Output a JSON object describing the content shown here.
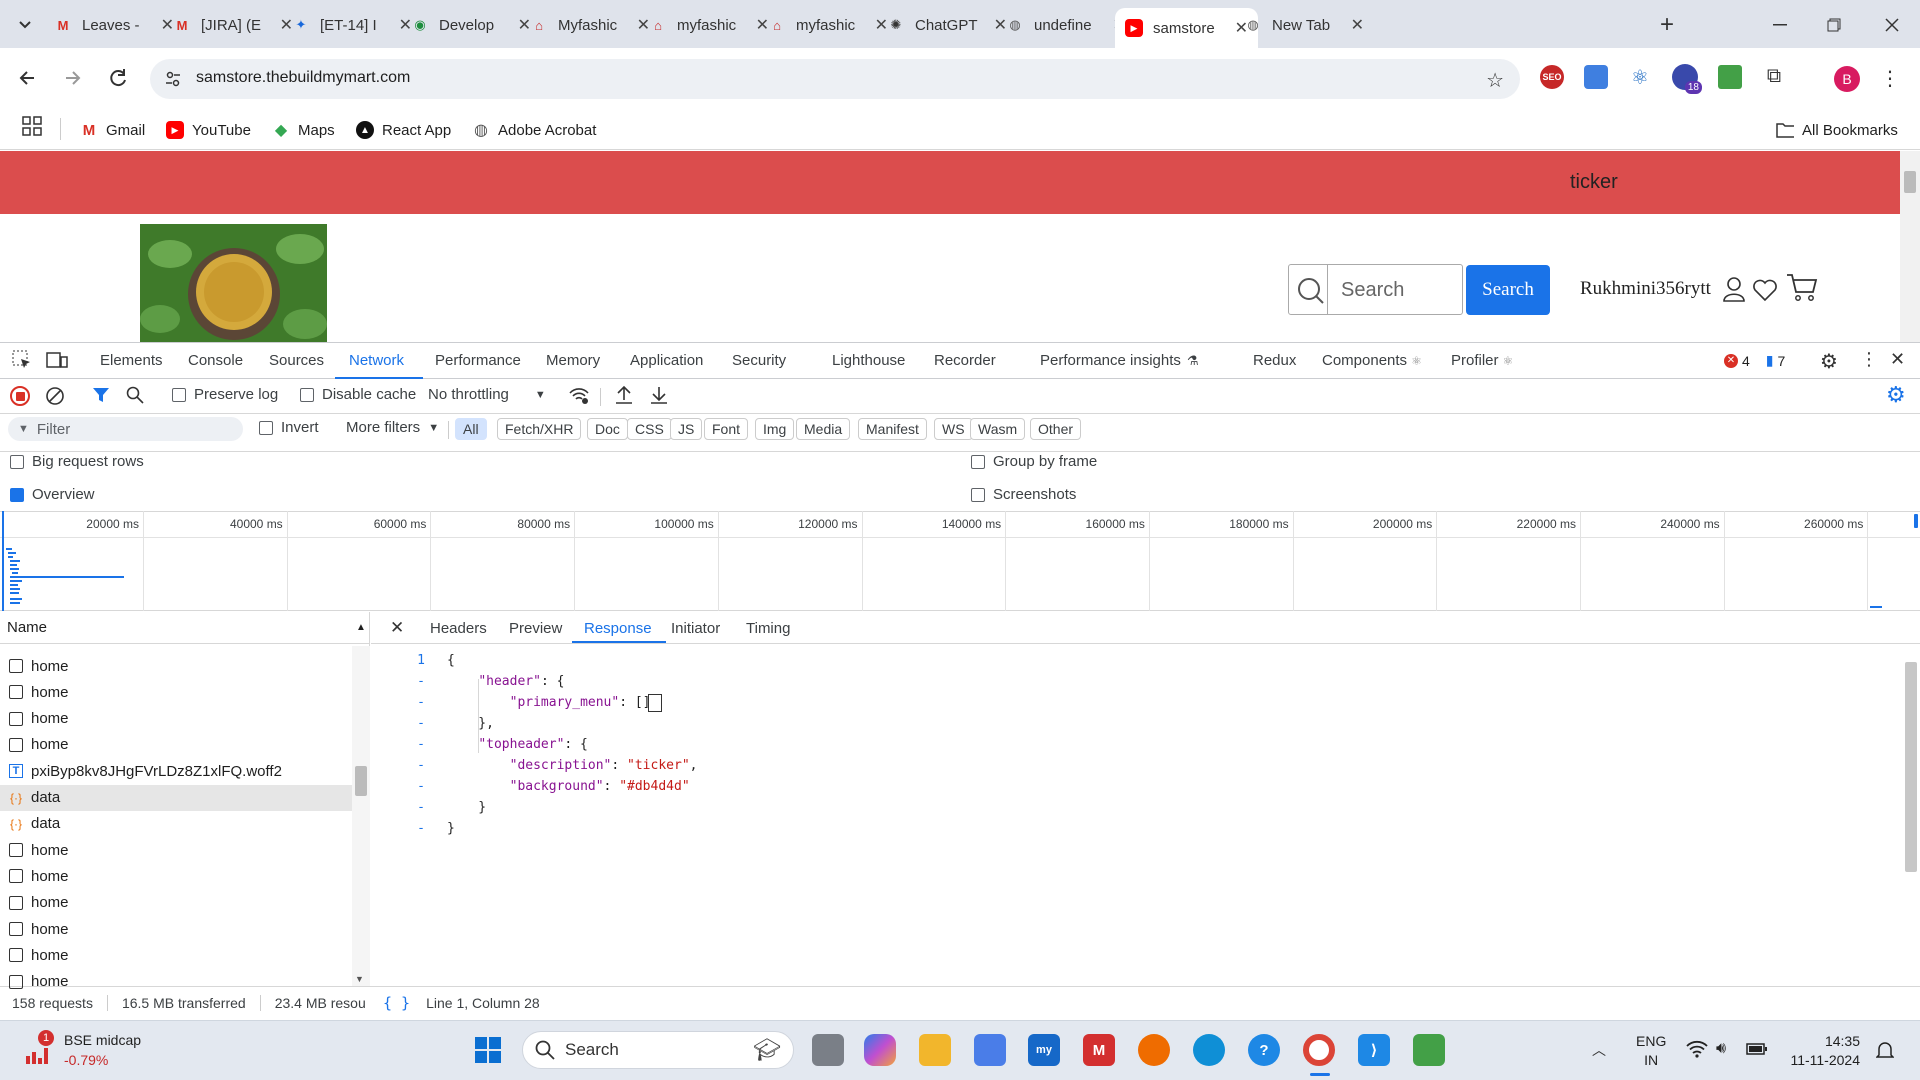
{
  "browser": {
    "tabs": [
      {
        "title": "Leaves -",
        "icon": "gmail-icon"
      },
      {
        "title": "[JIRA] (E",
        "icon": "gmail-icon"
      },
      {
        "title": "[ET-14] I",
        "icon": "jira-icon"
      },
      {
        "title": "Develop",
        "icon": "google-chat-icon"
      },
      {
        "title": "Myfashic",
        "icon": "myfashion-icon"
      },
      {
        "title": "myfashic",
        "icon": "myfashion-icon"
      },
      {
        "title": "myfashic",
        "icon": "myfashion-icon"
      },
      {
        "title": "ChatGPT",
        "icon": "chatgpt-icon"
      },
      {
        "title": "undefine",
        "icon": "globe-icon"
      },
      {
        "title": "samstore",
        "icon": "youtube-icon",
        "active": true
      },
      {
        "title": "New Tab",
        "icon": "chrome-icon"
      }
    ],
    "url": "samstore.thebuildmymart.com",
    "profile_initial": "B",
    "extension_badge": "18",
    "bookmarks": [
      "Gmail",
      "YouTube",
      "Maps",
      "React App",
      "Adobe Acrobat"
    ],
    "all_bookmarks": "All Bookmarks"
  },
  "page": {
    "ticker_text": "ticker",
    "ticker_color": "#db4d4d",
    "search_placeholder": "Search",
    "search_button": "Search",
    "username": "Rukhmini356rytt"
  },
  "devtools": {
    "tabs": [
      "Elements",
      "Console",
      "Sources",
      "Network",
      "Performance",
      "Memory",
      "Application",
      "Security",
      "Lighthouse",
      "Recorder",
      "Performance insights",
      "Redux",
      "Components",
      "Profiler"
    ],
    "active_tab": "Network",
    "error_count": "4",
    "message_count": "7",
    "preserve_log": "Preserve log",
    "disable_cache": "Disable cache",
    "throttling": "No throttling",
    "filter_placeholder": "Filter",
    "invert": "Invert",
    "more_filters": "More filters",
    "type_filters": [
      "All",
      "Fetch/XHR",
      "Doc",
      "CSS",
      "JS",
      "Font",
      "Img",
      "Media",
      "Manifest",
      "WS",
      "Wasm",
      "Other"
    ],
    "big_request_rows": "Big request rows",
    "overview": "Overview",
    "group_by_frame": "Group by frame",
    "screenshots": "Screenshots",
    "timeline_ticks": [
      "20000 ms",
      "40000 ms",
      "60000 ms",
      "80000 ms",
      "100000 ms",
      "120000 ms",
      "140000 ms",
      "160000 ms",
      "180000 ms",
      "200000 ms",
      "220000 ms",
      "240000 ms",
      "260000 ms"
    ],
    "name_header": "Name",
    "requests": [
      {
        "name": "home",
        "type": "doc"
      },
      {
        "name": "home",
        "type": "doc"
      },
      {
        "name": "home",
        "type": "doc"
      },
      {
        "name": "home",
        "type": "doc"
      },
      {
        "name": "pxiByp8kv8JHgFVrLDz8Z1xlFQ.woff2",
        "type": "font"
      },
      {
        "name": "data",
        "type": "xhr",
        "selected": true
      },
      {
        "name": "data",
        "type": "xhr"
      },
      {
        "name": "home",
        "type": "doc"
      },
      {
        "name": "home",
        "type": "doc"
      },
      {
        "name": "home",
        "type": "doc"
      },
      {
        "name": "home",
        "type": "doc"
      },
      {
        "name": "home",
        "type": "doc"
      },
      {
        "name": "home",
        "type": "doc"
      }
    ],
    "detail_tabs": [
      "Headers",
      "Preview",
      "Response",
      "Initiator",
      "Timing"
    ],
    "active_detail_tab": "Response",
    "response_lines": [
      {
        "n": "1",
        "text": "{"
      },
      {
        "n": "-",
        "text": "    \"header\": {"
      },
      {
        "n": "-",
        "text": "        \"primary_menu\": []"
      },
      {
        "n": "-",
        "text": "    },"
      },
      {
        "n": "-",
        "text": "    \"topheader\": {"
      },
      {
        "n": "-",
        "text": "        \"description\": \"ticker\","
      },
      {
        "n": "-",
        "text": "        \"background\": \"#db4d4d\""
      },
      {
        "n": "-",
        "text": "    }"
      },
      {
        "n": "-",
        "text": "}"
      }
    ],
    "status_requests": "158 requests",
    "status_transferred": "16.5 MB transferred",
    "status_resources": "23.4 MB resou",
    "cursor_position": "Line 1, Column 28"
  },
  "taskbar": {
    "stock_name": "BSE midcap",
    "stock_change": "-0.79%",
    "stock_badge": "1",
    "search": "Search",
    "lang": "ENG",
    "region": "IN",
    "time": "14:35",
    "date": "11-11-2024"
  }
}
